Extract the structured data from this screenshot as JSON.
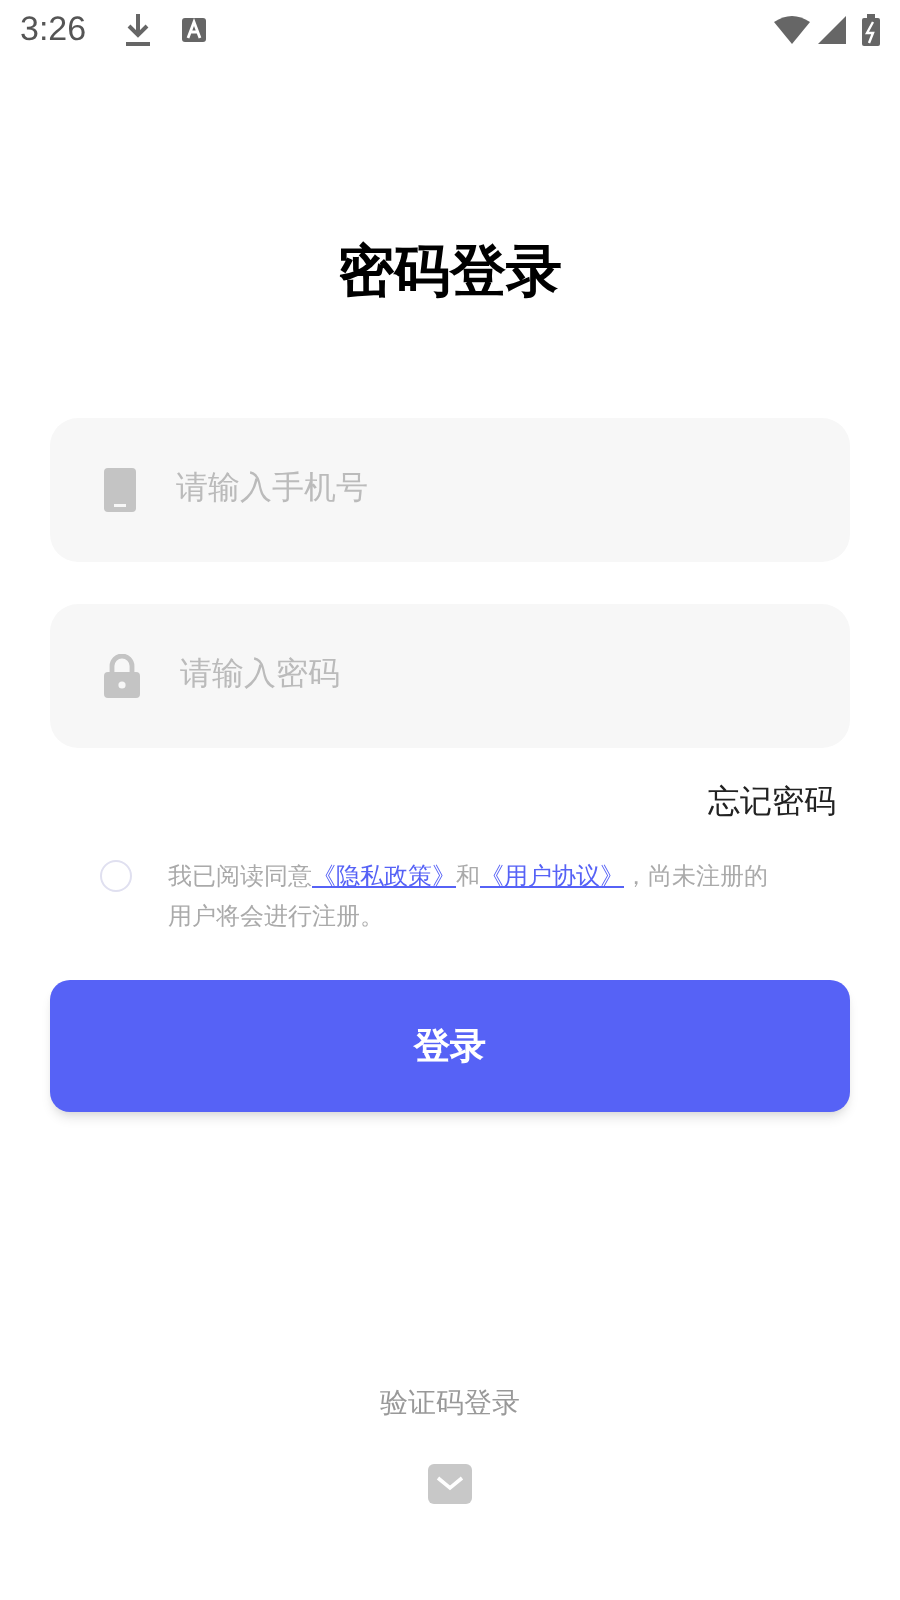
{
  "status_bar": {
    "time": "3:26"
  },
  "title": "密码登录",
  "fields": [
    {
      "kind": "phone",
      "placeholder": "请输入手机号"
    },
    {
      "kind": "password",
      "placeholder": "请输入密码"
    }
  ],
  "forgot_password": "忘记密码",
  "agreement": {
    "checked": false,
    "prefix": "我已阅读同意",
    "privacy_link": "《隐私政策》",
    "middle": "和",
    "terms_link": "《用户协议》",
    "suffix": "，尚未注册的用户将会进行注册。"
  },
  "login_button": "登录",
  "alt_login": {
    "label": "验证码登录"
  }
}
